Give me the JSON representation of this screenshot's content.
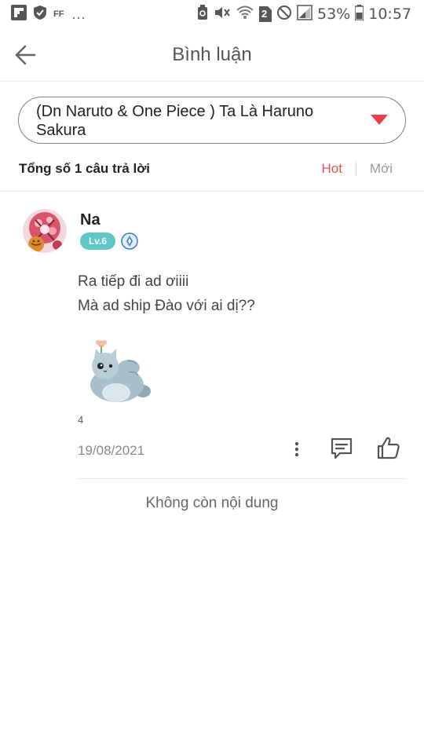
{
  "status_bar": {
    "notif_text": "FF",
    "more_indicator": "...",
    "sim_badge": "2",
    "battery": "53%",
    "time": "10:57",
    "icons": [
      "flipboard-icon",
      "shield-icon",
      "recycle-icon",
      "mute-icon",
      "wifi-icon",
      "sim-2-icon",
      "no-disturb-icon",
      "signal-icon",
      "battery-icon"
    ]
  },
  "header": {
    "title": "Bình luận"
  },
  "story": {
    "title": "(Dn Naruto & One Piece ) Ta Là Haruno Sakura"
  },
  "summary": {
    "total_label": "Tổng số 1 câu trả lời",
    "sort_hot": "Hot",
    "sort_new": "Mới"
  },
  "comment": {
    "username": "Na",
    "level": "Lv.6",
    "lines": [
      "Ra tiếp đi ad ơiiii",
      "Mà ad ship Đào với ai dị??"
    ],
    "sticker": "cat-sticker",
    "likes": "4",
    "date": "19/08/2021"
  },
  "footer": {
    "end_text": "Không còn nội dung"
  },
  "colors": {
    "accent": "#e8504a",
    "level_badge": "#5fc7c8",
    "vip_badge": "#3a7bd5"
  }
}
